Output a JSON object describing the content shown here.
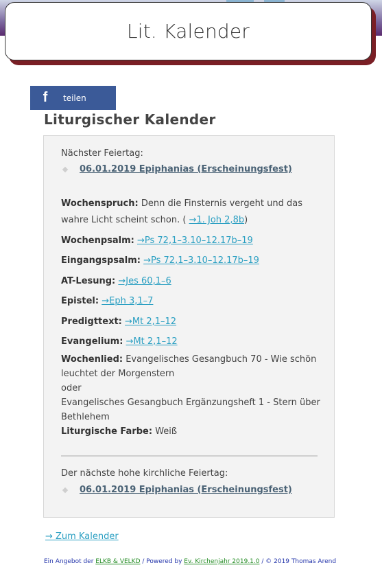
{
  "header": {
    "title": "Lit. Kalender"
  },
  "share": {
    "label": "teilen",
    "icon": "facebook-icon"
  },
  "page_title": "Liturgischer Kalender",
  "calendar": {
    "next_label": "Nächster Feiertag:",
    "next_feast": "06.01.2019 Epiphanias (Erscheinungsfest)",
    "wochenspruch": {
      "label": "Wochenspruch:",
      "text": "Denn die Finsternis vergeht und das wahre Licht scheint schon. (",
      "ref": "→1. Joh 2,8b",
      "close": ")"
    },
    "entries": [
      {
        "label": "Wochenpsalm:",
        "ref": "→Ps 72,1–3.10–12.17b–19"
      },
      {
        "label": "Eingangspsalm:",
        "ref": "→Ps 72,1–3.10–12.17b–19"
      },
      {
        "label": "AT-Lesung:",
        "ref": "→Jes 60,1–6"
      },
      {
        "label": "Epistel:",
        "ref": "→Eph 3,1–7"
      },
      {
        "label": "Predigttext:",
        "ref": "→Mt 2,1–12"
      },
      {
        "label": "Evangelium:",
        "ref": "→Mt 2,1–12"
      }
    ],
    "wochenlied": {
      "label": "Wochenlied:",
      "line1": "Evangelisches Gesangbuch 70 - Wie schön leuchtet der Morgenstern",
      "or": "oder",
      "line2": "Evangelisches Gesangbuch Ergänzungsheft 1 - Stern über Bethlehem"
    },
    "farbe": {
      "label": "Liturgische Farbe:",
      "value": "Weiß"
    },
    "next_high_label": "Der nächste hohe kirchliche Feiertag:",
    "next_high_feast": "06.01.2019 Epiphanias (Erscheinungsfest)"
  },
  "calendar_link": "→ Zum Kalender",
  "footer": {
    "prefix": "Ein Angebot der ",
    "org_link": "ELKB & VELKD",
    "middle": " / Powered by ",
    "powered_link": "Ev. Kirchenjahr 2019.1.0",
    "suffix": " / © 2019 Thomas Arend"
  }
}
